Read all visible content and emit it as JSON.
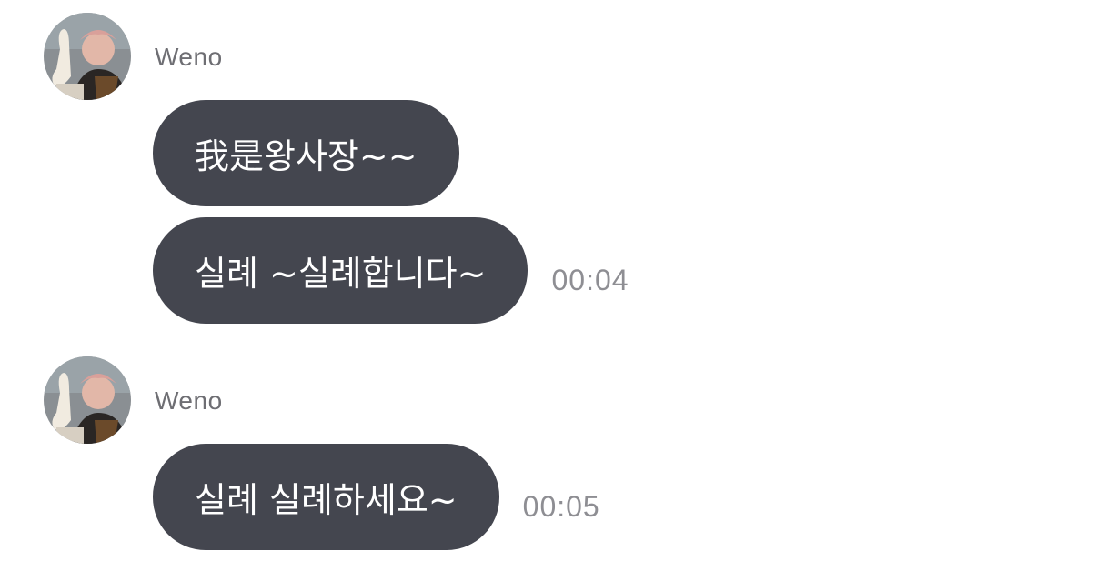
{
  "colors": {
    "background": "#ffffff",
    "bubble": "#44464f",
    "bubble_text": "#ffffff",
    "sender_name": "#6e6e73",
    "timestamp": "#8e8e93"
  },
  "groups": [
    {
      "sender": "Weno",
      "avatar_icon": "user-avatar-photo",
      "messages": [
        {
          "text": "我是왕사장~~",
          "time": ""
        },
        {
          "text": "실례 ~실례합니다~",
          "time": "00:04"
        }
      ]
    },
    {
      "sender": "Weno",
      "avatar_icon": "user-avatar-photo",
      "messages": [
        {
          "text": "실례 실례하세요~",
          "time": "00:05"
        }
      ]
    }
  ]
}
